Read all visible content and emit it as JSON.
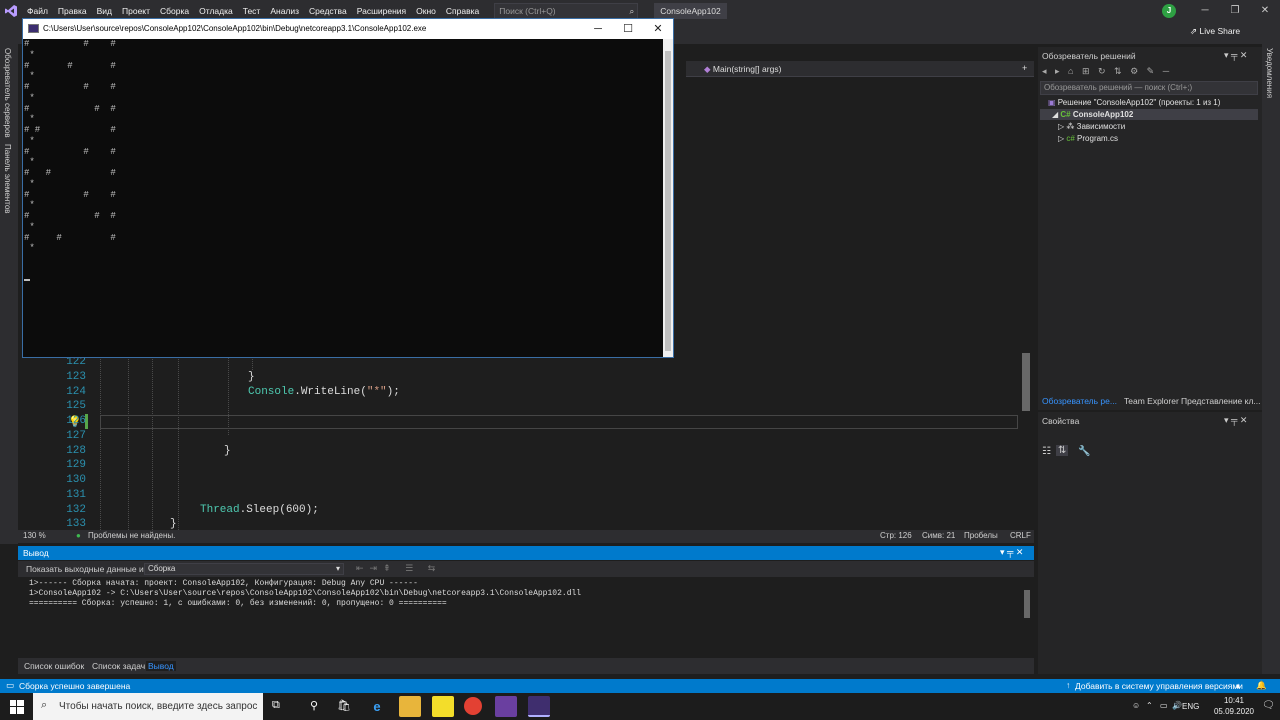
{
  "menu": {
    "items": [
      "Файл",
      "Правка",
      "Вид",
      "Проект",
      "Сборка",
      "Отладка",
      "Тест",
      "Анализ",
      "Средства",
      "Расширения",
      "Окно",
      "Справка"
    ],
    "search_placeholder": "Поиск (Ctrl+Q)",
    "solution_name": "ConsoleApp102",
    "user_initial": "J",
    "live_share": "Live Share"
  },
  "left_tabs": {
    "server_explorer": "Обозреватель серверов",
    "toolbox": "Панель элементов"
  },
  "right_tabs": {
    "notifications": "Уведомления"
  },
  "editor": {
    "member_dropdown": "Main(string[] args)",
    "lines": [
      {
        "num": "122",
        "parts": []
      },
      {
        "num": "123",
        "parts": [
          {
            "t": "}",
            "c": "plain"
          }
        ]
      },
      {
        "num": "124",
        "parts": [
          {
            "t": "Console",
            "c": "cls"
          },
          {
            "t": ".WriteLine(",
            "c": "plain"
          },
          {
            "t": "\"*\"",
            "c": "str"
          },
          {
            "t": ");",
            "c": "plain"
          }
        ]
      },
      {
        "num": "125",
        "parts": []
      },
      {
        "num": "126",
        "parts": []
      },
      {
        "num": "127",
        "parts": []
      },
      {
        "num": "128",
        "parts": [
          {
            "t": "}",
            "c": "plain"
          }
        ]
      },
      {
        "num": "129",
        "parts": []
      },
      {
        "num": "130",
        "parts": []
      },
      {
        "num": "131",
        "parts": []
      },
      {
        "num": "132",
        "parts": [
          {
            "t": "Thread",
            "c": "cls"
          },
          {
            "t": ".Sleep(600);",
            "c": "plain"
          }
        ]
      },
      {
        "num": "133",
        "parts": [
          {
            "t": "}",
            "c": "plain"
          }
        ]
      }
    ],
    "status": {
      "zoom": "130 %",
      "issues": "Проблемы не найдены.",
      "line": "Стр: 126",
      "col": "Симв: 21",
      "spaces": "Пробелы",
      "eol": "CRLF"
    }
  },
  "console": {
    "title": "C:\\Users\\User\\source\\repos\\ConsoleApp102\\ConsoleApp102\\bin\\Debug\\netcoreapp3.1\\ConsoleApp102.exe",
    "output_lines": [
      "#          #    #",
      " *",
      "#       #       #",
      " *",
      "#          #    #",
      " *",
      "#            #  #",
      " *",
      "# #             #",
      " *",
      "#          #    #",
      " *",
      "#   #           #",
      " *",
      "#          #    #",
      " *",
      "#            #  #",
      " *",
      "#     #         #",
      " *"
    ]
  },
  "solution_explorer": {
    "title": "Обозреватель решений",
    "search_placeholder": "Обозреватель решений — поиск (Ctrl+;)",
    "solution_label": "Решение \"ConsoleApp102\" (проекты: 1 из 1)",
    "project_label": "ConsoleApp102",
    "dependencies_label": "Зависимости",
    "program_label": "Program.cs",
    "tabs": [
      "Обозреватель ре...",
      "Team Explorer",
      "Представление кл..."
    ]
  },
  "properties": {
    "title": "Свойства"
  },
  "output": {
    "title": "Вывод",
    "show_from_label": "Показать выходные данные из:",
    "show_from_value": "Сборка",
    "lines": [
      "1>------ Сборка начата: проект: ConsoleApp102, Конфигурация: Debug Any CPU ------",
      "1>ConsoleApp102 -> C:\\Users\\User\\source\\repos\\ConsoleApp102\\ConsoleApp102\\bin\\Debug\\netcoreapp3.1\\ConsoleApp102.dll",
      "========== Сборка: успешно: 1, с ошибками: 0, без изменений: 0, пропущено: 0 =========="
    ]
  },
  "bottom_tabs": [
    "Список ошибок",
    "Список задач",
    "Вывод"
  ],
  "statusbar": {
    "message": "Сборка успешно завершена",
    "source_control": "Добавить в систему управления версиями"
  },
  "taskbar": {
    "search_placeholder": "Чтобы начать поиск, введите здесь запрос",
    "language": "ENG",
    "time": "10:41",
    "date": "05.09.2020"
  },
  "colors": {
    "accent": "#007acc",
    "menubar": "#2d2d30",
    "editor_bg": "#1e1e1e",
    "type_name": "#4ec9b0",
    "string": "#d69d85"
  }
}
